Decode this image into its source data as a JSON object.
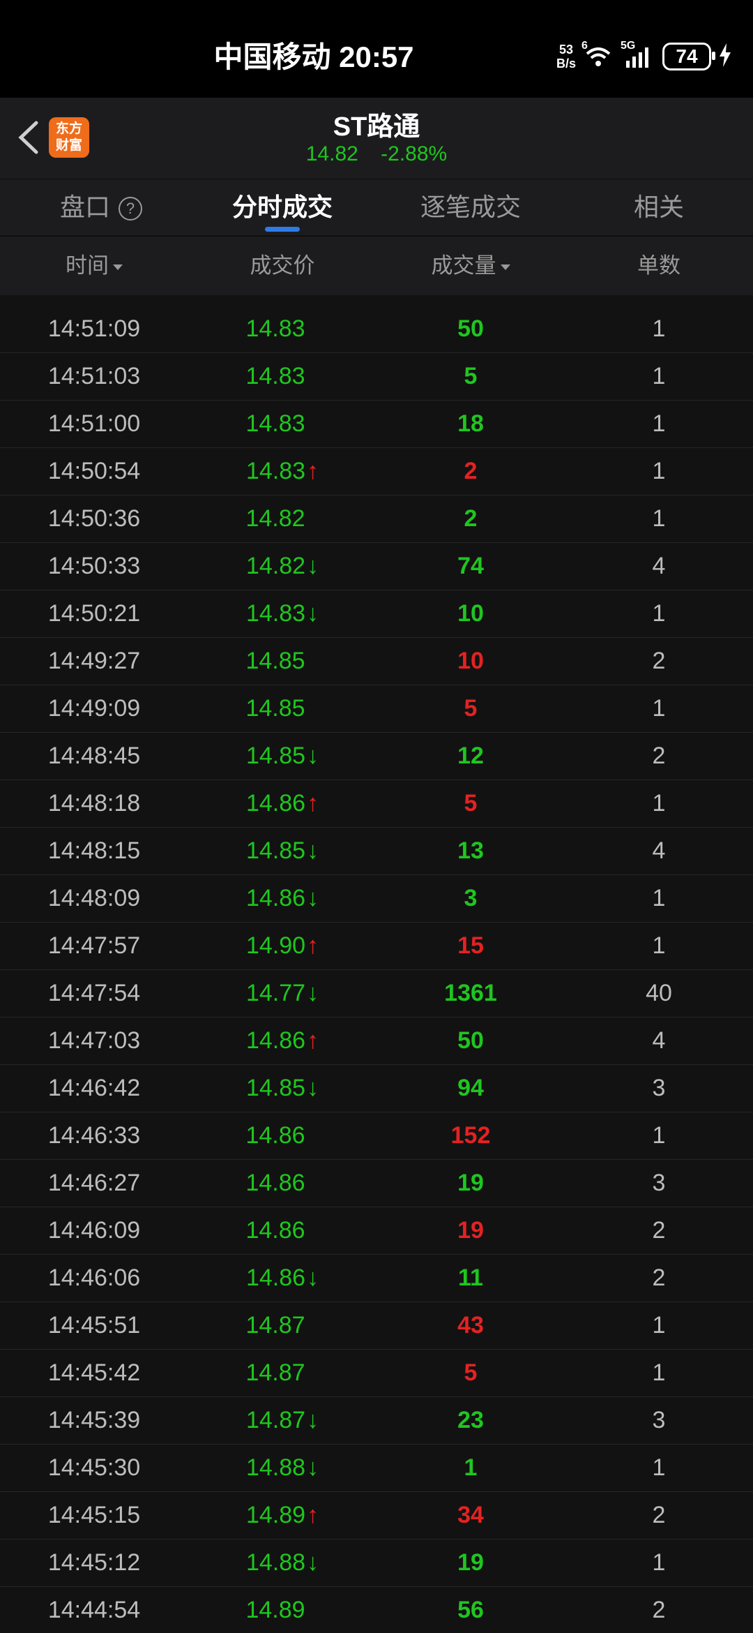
{
  "status_bar": {
    "carrier_time": "中国移动 20:57",
    "net_speed_value": "53",
    "net_speed_unit": "B/s",
    "wifi_sup": "6",
    "signal_label": "5G",
    "battery": "74"
  },
  "header": {
    "logo_line1": "东方",
    "logo_line2": "财富",
    "title": "ST路通",
    "price": "14.82",
    "change": "-2.88%"
  },
  "tabs": [
    {
      "label": "盘口",
      "active": false
    },
    {
      "label": "分时成交",
      "active": true
    },
    {
      "label": "逐笔成交",
      "active": false
    },
    {
      "label": "相关",
      "active": false
    }
  ],
  "columns": {
    "time": "时间",
    "price": "成交价",
    "volume": "成交量",
    "count": "单数"
  },
  "colors": {
    "up": "#e52222",
    "down": "#1fc61f",
    "accent": "#2d7ce6"
  },
  "rows": [
    {
      "time": "14:51:09",
      "price": "14.83",
      "arrow": "",
      "vol": "50",
      "vol_color": "green",
      "count": "1"
    },
    {
      "time": "14:51:03",
      "price": "14.83",
      "arrow": "",
      "vol": "5",
      "vol_color": "green",
      "count": "1"
    },
    {
      "time": "14:51:00",
      "price": "14.83",
      "arrow": "",
      "vol": "18",
      "vol_color": "green",
      "count": "1"
    },
    {
      "time": "14:50:54",
      "price": "14.83",
      "arrow": "up",
      "vol": "2",
      "vol_color": "red",
      "count": "1"
    },
    {
      "time": "14:50:36",
      "price": "14.82",
      "arrow": "",
      "vol": "2",
      "vol_color": "green",
      "count": "1"
    },
    {
      "time": "14:50:33",
      "price": "14.82",
      "arrow": "down",
      "vol": "74",
      "vol_color": "green",
      "count": "4"
    },
    {
      "time": "14:50:21",
      "price": "14.83",
      "arrow": "down",
      "vol": "10",
      "vol_color": "green",
      "count": "1"
    },
    {
      "time": "14:49:27",
      "price": "14.85",
      "arrow": "",
      "vol": "10",
      "vol_color": "red",
      "count": "2"
    },
    {
      "time": "14:49:09",
      "price": "14.85",
      "arrow": "",
      "vol": "5",
      "vol_color": "red",
      "count": "1"
    },
    {
      "time": "14:48:45",
      "price": "14.85",
      "arrow": "down",
      "vol": "12",
      "vol_color": "green",
      "count": "2"
    },
    {
      "time": "14:48:18",
      "price": "14.86",
      "arrow": "up",
      "vol": "5",
      "vol_color": "red",
      "count": "1"
    },
    {
      "time": "14:48:15",
      "price": "14.85",
      "arrow": "down",
      "vol": "13",
      "vol_color": "green",
      "count": "4"
    },
    {
      "time": "14:48:09",
      "price": "14.86",
      "arrow": "down",
      "vol": "3",
      "vol_color": "green",
      "count": "1"
    },
    {
      "time": "14:47:57",
      "price": "14.90",
      "arrow": "up",
      "vol": "15",
      "vol_color": "red",
      "count": "1"
    },
    {
      "time": "14:47:54",
      "price": "14.77",
      "arrow": "down",
      "vol": "1361",
      "vol_color": "green",
      "count": "40"
    },
    {
      "time": "14:47:03",
      "price": "14.86",
      "arrow": "up",
      "vol": "50",
      "vol_color": "green",
      "count": "4"
    },
    {
      "time": "14:46:42",
      "price": "14.85",
      "arrow": "down",
      "vol": "94",
      "vol_color": "green",
      "count": "3"
    },
    {
      "time": "14:46:33",
      "price": "14.86",
      "arrow": "",
      "vol": "152",
      "vol_color": "red",
      "count": "1"
    },
    {
      "time": "14:46:27",
      "price": "14.86",
      "arrow": "",
      "vol": "19",
      "vol_color": "green",
      "count": "3"
    },
    {
      "time": "14:46:09",
      "price": "14.86",
      "arrow": "",
      "vol": "19",
      "vol_color": "red",
      "count": "2"
    },
    {
      "time": "14:46:06",
      "price": "14.86",
      "arrow": "down",
      "vol": "11",
      "vol_color": "green",
      "count": "2"
    },
    {
      "time": "14:45:51",
      "price": "14.87",
      "arrow": "",
      "vol": "43",
      "vol_color": "red",
      "count": "1"
    },
    {
      "time": "14:45:42",
      "price": "14.87",
      "arrow": "",
      "vol": "5",
      "vol_color": "red",
      "count": "1"
    },
    {
      "time": "14:45:39",
      "price": "14.87",
      "arrow": "down",
      "vol": "23",
      "vol_color": "green",
      "count": "3"
    },
    {
      "time": "14:45:30",
      "price": "14.88",
      "arrow": "down",
      "vol": "1",
      "vol_color": "green",
      "count": "1"
    },
    {
      "time": "14:45:15",
      "price": "14.89",
      "arrow": "up",
      "vol": "34",
      "vol_color": "red",
      "count": "2"
    },
    {
      "time": "14:45:12",
      "price": "14.88",
      "arrow": "down",
      "vol": "19",
      "vol_color": "green",
      "count": "1"
    },
    {
      "time": "14:44:54",
      "price": "14.89",
      "arrow": "",
      "vol": "56",
      "vol_color": "green",
      "count": "2"
    }
  ]
}
